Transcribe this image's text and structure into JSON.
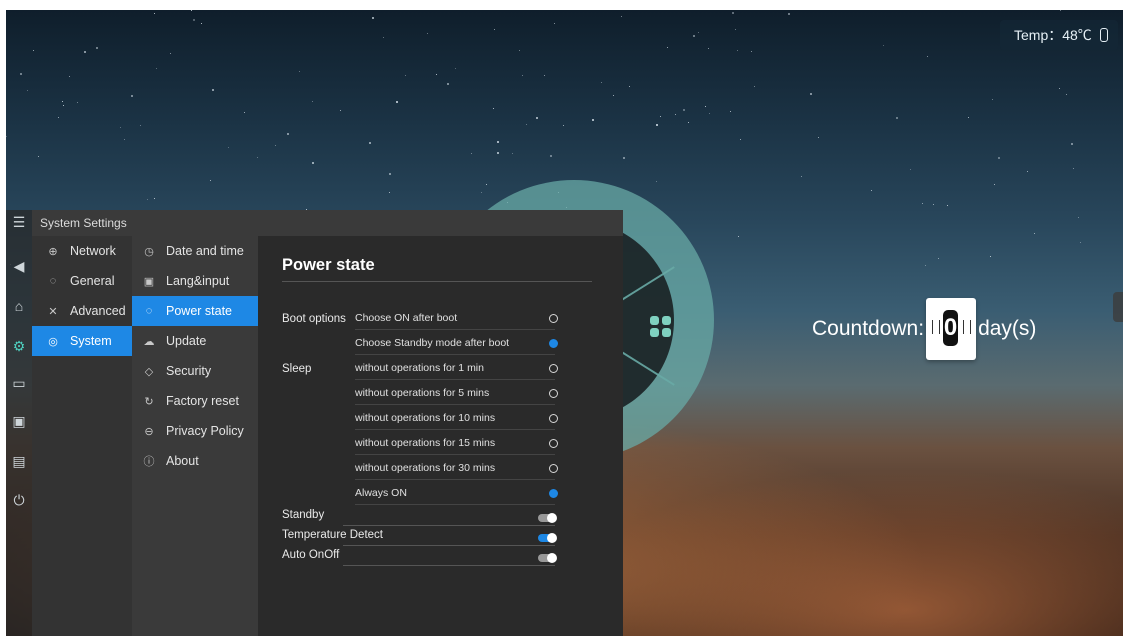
{
  "status": {
    "temp_label": "Temp：48℃"
  },
  "window": {
    "title": "System Settings"
  },
  "nav_primary": [
    {
      "label": "Network",
      "icon": "globe-icon"
    },
    {
      "label": "General",
      "icon": "palette-icon"
    },
    {
      "label": "Advanced",
      "icon": "tools-icon"
    },
    {
      "label": "System",
      "icon": "system-icon",
      "active": true
    }
  ],
  "nav_secondary": [
    {
      "label": "Date and time",
      "icon": "clock-icon"
    },
    {
      "label": "Lang&input",
      "icon": "keyboard-icon"
    },
    {
      "label": "Power state",
      "icon": "power-icon",
      "active": true
    },
    {
      "label": "Update",
      "icon": "cloud-icon"
    },
    {
      "label": "Security",
      "icon": "shield-icon"
    },
    {
      "label": "Factory reset",
      "icon": "reset-icon"
    },
    {
      "label": "Privacy Policy",
      "icon": "lock-icon"
    },
    {
      "label": "About",
      "icon": "info-icon"
    }
  ],
  "panel": {
    "title": "Power state",
    "boot_label": "Boot options",
    "boot_options": [
      {
        "label": "Choose ON after boot",
        "selected": false
      },
      {
        "label": "Choose Standby mode after boot",
        "selected": true
      }
    ],
    "sleep_label": "Sleep",
    "sleep_options": [
      {
        "label": "without operations for 1 min",
        "selected": false
      },
      {
        "label": "without operations for 5 mins",
        "selected": false
      },
      {
        "label": "without operations for 10 mins",
        "selected": false
      },
      {
        "label": "without operations for 15 mins",
        "selected": false
      },
      {
        "label": "without operations for 30 mins",
        "selected": false
      },
      {
        "label": "Always ON",
        "selected": true
      }
    ],
    "toggles": [
      {
        "label": "Standby",
        "on": false
      },
      {
        "label": "Temperature Detect",
        "on": true
      },
      {
        "label": "Auto OnOff",
        "on": false
      }
    ]
  },
  "countdown": {
    "label": "Countdown:",
    "value": "0",
    "unit": "day(s)"
  },
  "colors": {
    "accent": "#1e88e5",
    "wheel": "#68aaa5"
  }
}
